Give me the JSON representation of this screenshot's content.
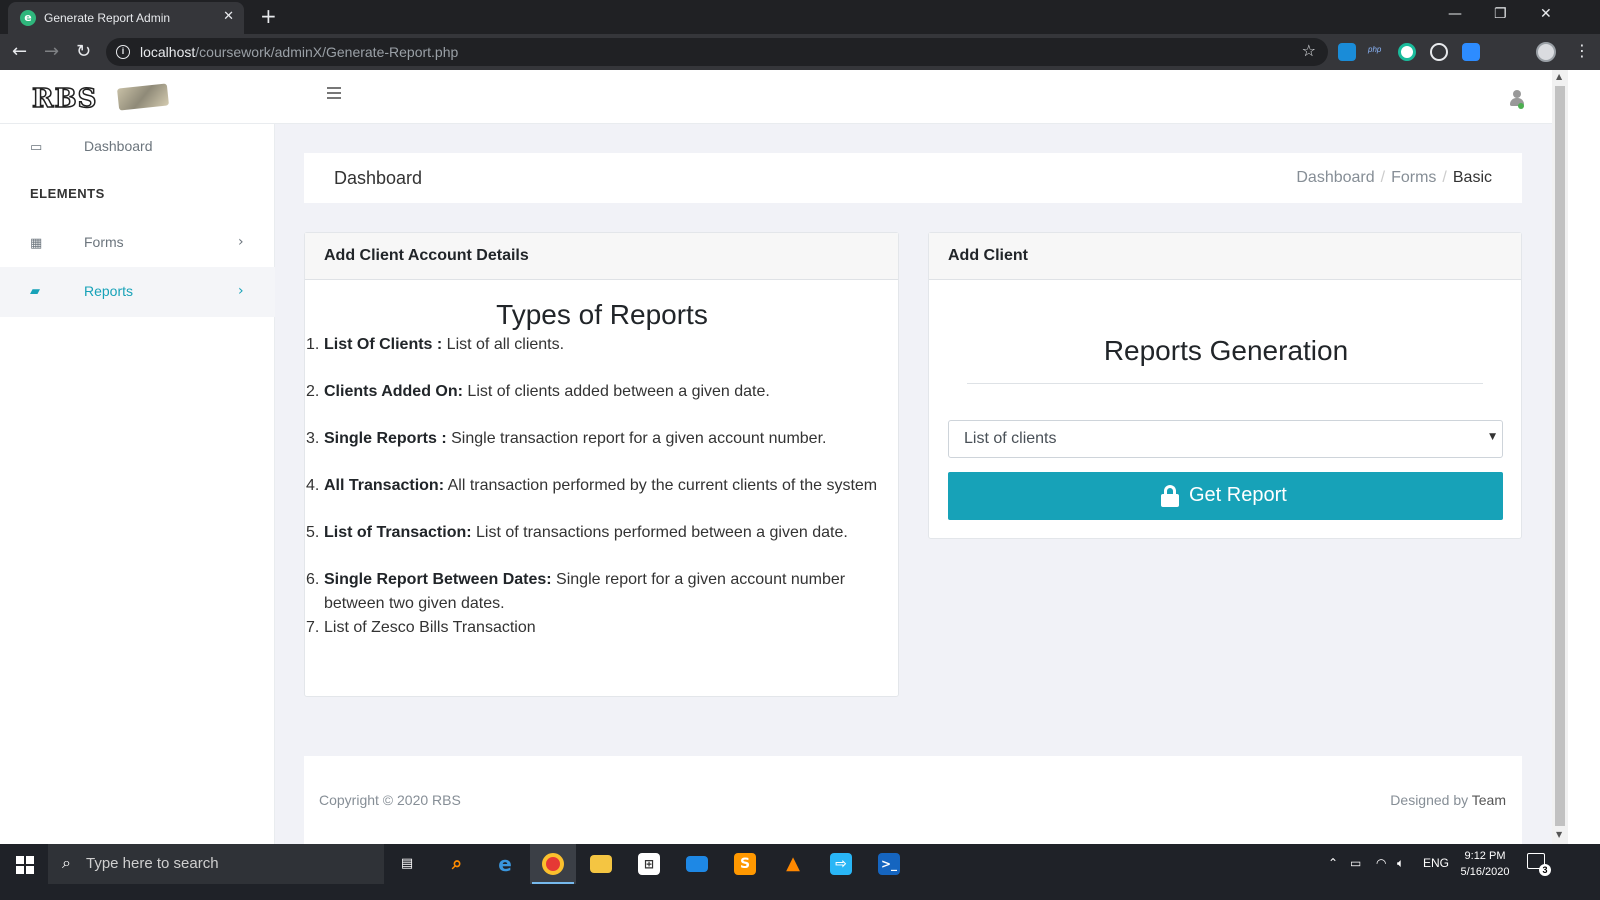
{
  "browser": {
    "tab_title": "Generate Report Admin",
    "tab_favicon_letter": "e",
    "url_host": "localhost",
    "url_path": "/coursework/adminX/Generate-Report.php",
    "ext_php_label": "php"
  },
  "header": {
    "logo_text": "RBS"
  },
  "sidebar": {
    "section_heading": "ELEMENTS",
    "items": [
      {
        "label": "Dashboard",
        "icon": "laptop-icon",
        "active": false
      },
      {
        "label": "Forms",
        "icon": "grid-icon",
        "active": false
      },
      {
        "label": "Reports",
        "icon": "book-icon",
        "active": true
      }
    ]
  },
  "breadcrumb": {
    "page_title": "Dashboard",
    "trail": [
      "Dashboard",
      "Forms",
      "Basic"
    ]
  },
  "details_card": {
    "header": "Add Client Account Details",
    "title": "Types of Reports",
    "reports": [
      {
        "num": "1.",
        "name": "List Of Clients :",
        "desc": " List of all clients."
      },
      {
        "num": "2.",
        "name": "Clients Added On:",
        "desc": " List of clients added between a given date."
      },
      {
        "num": "3.",
        "name": "Single Reports :",
        "desc": " Single transaction report for a given account number."
      },
      {
        "num": "4.",
        "name": "All Transaction:",
        "desc": " All transaction performed by the current clients of the system"
      },
      {
        "num": "5.",
        "name": "List of Transaction:",
        "desc": " List of transactions performed between a given date."
      },
      {
        "num": "6.",
        "name": "Single Report Between Dates:",
        "desc": " Single report for a given account number between two given dates."
      },
      {
        "num": "7.",
        "name": "",
        "desc": "List of Zesco Bills Transaction"
      }
    ]
  },
  "client_card": {
    "header": "Add Client",
    "title": "Reports Generation",
    "select_value": "List of clients",
    "button_label": "Get Report"
  },
  "footer": {
    "copyright": "Copyright © 2020 RBS",
    "designed_prefix": "Designed by ",
    "designed_by": "Team"
  },
  "taskbar": {
    "search_placeholder": "Type here to search",
    "language": "ENG",
    "time": "9:12 PM",
    "date": "5/16/2020",
    "notification_count": "3"
  },
  "colors": {
    "accent": "#17a2b8",
    "content_bg": "#f1f2f7",
    "chrome_dark": "#202124"
  }
}
